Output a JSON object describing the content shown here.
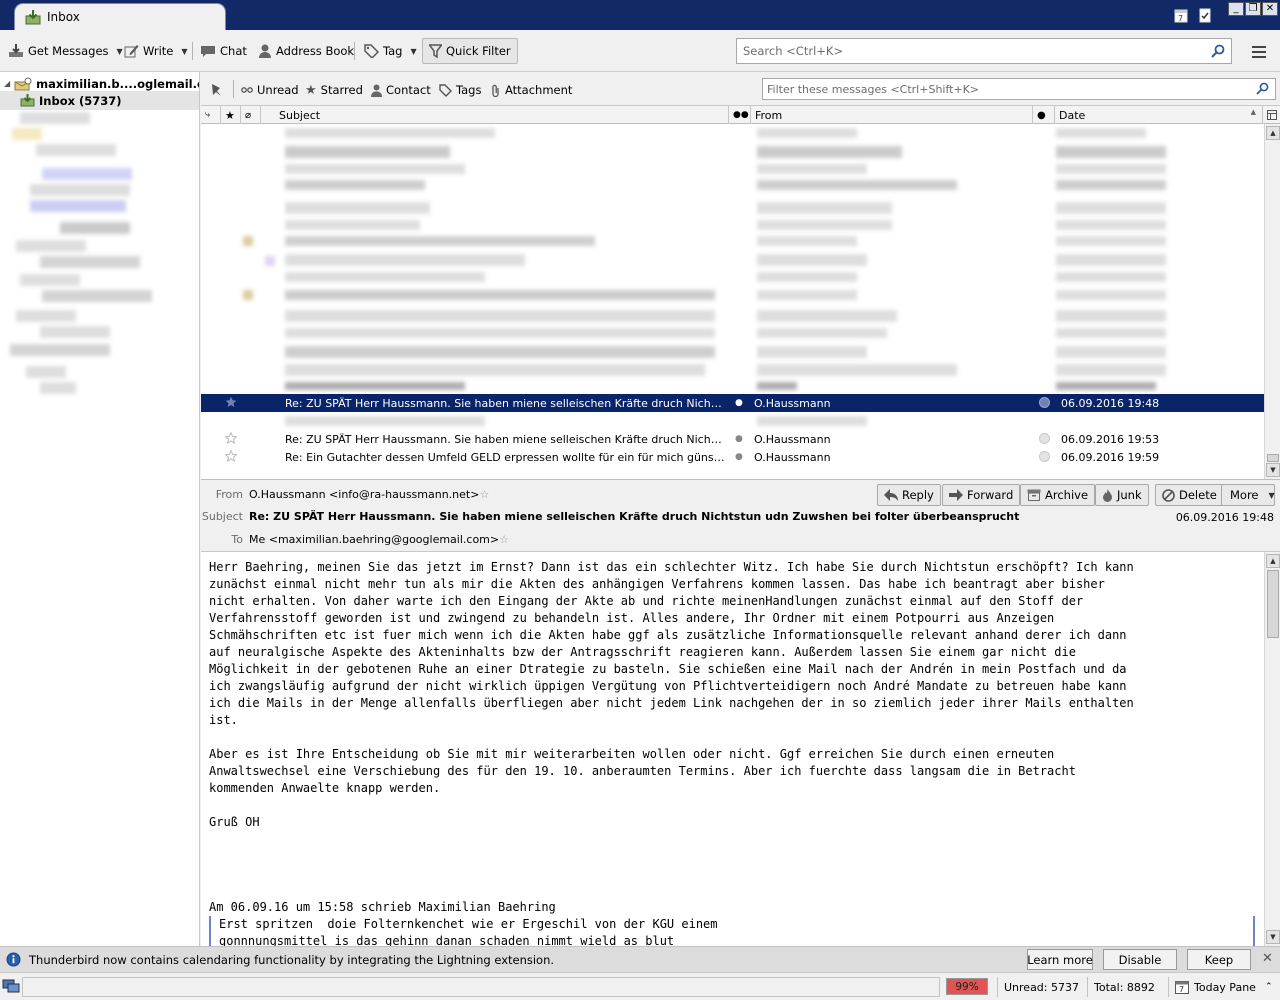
{
  "window": {
    "tab_title": "Inbox",
    "minimize": "_",
    "maximize": "❐",
    "close": "✕"
  },
  "toolbar": {
    "get_messages": "Get Messages",
    "write": "Write",
    "chat": "Chat",
    "address_book": "Address Book",
    "tag": "Tag",
    "quick_filter": "Quick Filter",
    "search_placeholder": "Search <Ctrl+K>"
  },
  "folders": {
    "account": "maximilian.b....oglemail.com",
    "inbox": "Inbox (5737)"
  },
  "quickfilter": {
    "unread": "Unread",
    "starred": "Starred",
    "contact": "Contact",
    "tags": "Tags",
    "attachment": "Attachment",
    "filter_placeholder": "Filter these messages <Ctrl+Shift+K>"
  },
  "columns": {
    "subject": "Subject",
    "from": "From",
    "date": "Date"
  },
  "messages": [
    {
      "subject": "Re: ZU SPÄT Herr Haussmann. Sie haben miene selleischen Kräfte druch Nichtstun udn Zu...",
      "from": "O.Haussmann",
      "date": "06.09.2016 19:48",
      "selected": true
    },
    {
      "subject": "Re: ZU SPÄT Herr Haussmann. Sie haben miene selleischen Kräfte druch Nichtstun udn Zu...",
      "from": "O.Haussmann",
      "date": "06.09.2016 19:53",
      "selected": false
    },
    {
      "subject": "Re: Ein Gutachter dessen Umfeld GELD erpressen wollte für ein für mich günstiges Zwotgu...",
      "from": "O.Haussmann",
      "date": "06.09.2016 19:59",
      "selected": false
    }
  ],
  "header": {
    "from_label": "From",
    "from_value": "O.Haussmann <info@ra-haussmann.net>",
    "subject_label": "Subject",
    "subject_value": "Re: ZU SPÄT Herr Haussmann. Sie haben miene selleischen Kräfte druch Nichtstun udn Zuwshen bei folter überbeansprucht",
    "to_label": "To",
    "to_value": "Me <maximilian.baehring@googlemail.com>",
    "date": "06.09.2016 19:48",
    "reply": "Reply",
    "forward": "Forward",
    "archive": "Archive",
    "junk": "Junk",
    "delete": "Delete",
    "more": "More"
  },
  "body": {
    "text": "Herr Baehring, meinen Sie das jetzt im Ernst? Dann ist das ein schlechter Witz. Ich habe Sie durch Nichtstun erschöpft? Ich kann\nzunächst einmal nicht mehr tun als mir die Akten des anhängigen Verfahrens kommen lassen. Das habe ich beantragt aber bisher\nnicht erhalten. Von daher warte ich den Eingang der Akte ab und richte meinenHandlungen zunächst einmal auf den Stoff der\nVerfahrensstoff geworden ist und zwingend zu behandeln ist. Alles andere, Ihr Ordner mit einem Potpourri aus Anzeigen\nSchmähschriften etc ist fuer mich wenn ich die Akten habe ggf als zusätzliche Informationsquelle relevant anhand derer ich dann\nauf neuralgische Aspekte des Akteninhalts bzw der Antragsschrift reagieren kann. Außerdem lassen Sie einem gar nicht die\nMöglichkeit in der gebotenen Ruhe an einer Dtrategie zu basteln. Sie schießen eine Mail nach der Andrén in mein Postfach und da\nich zwangsläufig aufgrund der nicht wirklich üppigen Vergütung von Pflichtverteidigern noch André Mandate zu betreuen habe kann\nich die Mails in der Menge allenfalls überfliegen aber nicht jedem Link nachgehen der in so ziemlich jeder ihrer Mails enthalten\nist.\n\nAber es ist Ihre Entscheidung ob Sie mit mir weiterarbeiten wollen oder nicht. Ggf erreichen Sie durch einen erneuten\nAnwaltswechsel eine Verschiebung des für den 19. 10. anberaumten Termins. Aber ich fuerchte dass langsam die in Betracht\nkommenden Anwaelte knapp werden.\n\nGruß OH\n\n\n\n\nAm 06.09.16 um 15:58 schrieb Maximilian Baehring",
    "quote": "Erst spritzen  doie Folternkenchet wie er Ergeschil von der KGU einem\ngonnnungsmittel is das gehinn danan schaden nimmt wield as blut"
  },
  "notification": {
    "text": "Thunderbird now contains calendaring functionality by integrating the Lightning extension.",
    "learn_more": "Learn more",
    "disable": "Disable",
    "keep": "Keep"
  },
  "status": {
    "progress": "99%",
    "unread": "Unread: 5737",
    "total": "Total: 8892",
    "today_pane": "Today Pane"
  }
}
